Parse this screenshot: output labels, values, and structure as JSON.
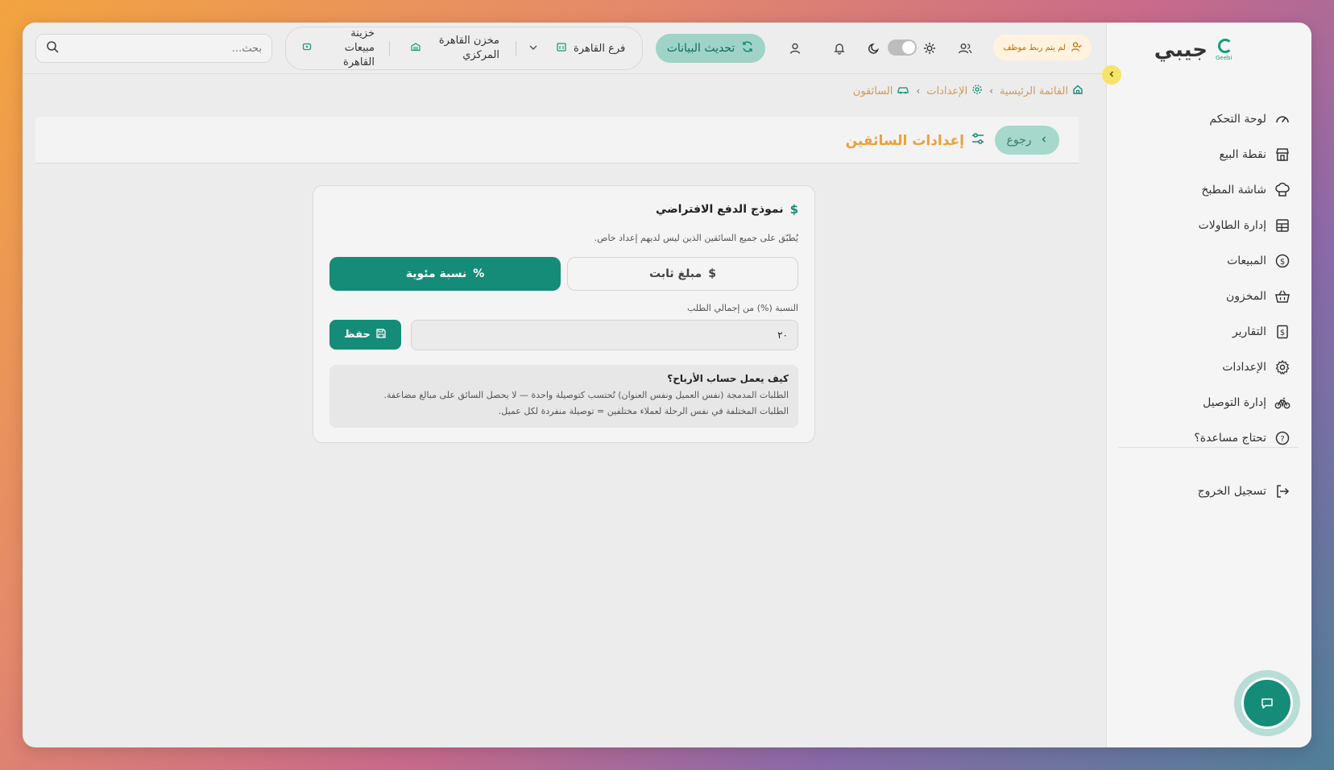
{
  "app": {
    "brand_name": "جيبي",
    "brand_logo_text": "Geebi"
  },
  "sidebar": {
    "items": [
      {
        "label": "لوحة التحكم",
        "icon": "gauge-icon"
      },
      {
        "label": "نقطة البيع",
        "icon": "store-icon"
      },
      {
        "label": "شاشة المطبخ",
        "icon": "chef-hat-icon"
      },
      {
        "label": "إدارة الطاولات",
        "icon": "table-grid-icon"
      },
      {
        "label": "المبيعات",
        "icon": "dollar-circle-icon"
      },
      {
        "label": "المخزون",
        "icon": "basket-icon"
      },
      {
        "label": "التقارير",
        "icon": "report-dollar-icon"
      },
      {
        "label": "الإعدادات",
        "icon": "gear-icon"
      },
      {
        "label": "إدارة التوصيل",
        "icon": "bike-icon"
      },
      {
        "label": "تحتاج مساعدة؟",
        "icon": "help-circle-icon"
      }
    ],
    "logout_label": "تسجيل الخروج"
  },
  "topbar": {
    "search_placeholder": "بحث...",
    "treasury": "خزينة مبيعات القاهرة",
    "warehouse": "مخزن القاهرة المركزي",
    "branch": "فرع القاهرة",
    "refresh_label": "تحديث البيانات",
    "employee_badge": "لم يتم ربط موظف"
  },
  "breadcrumb": {
    "home": "القائمة الرئيسية",
    "settings": "الإعدادات",
    "drivers": "السائقون"
  },
  "page": {
    "back_label": "رجوع",
    "title": "إعدادات السائقين"
  },
  "card": {
    "title": "نموذج الدفع الافتراضي",
    "subtitle": "يُطبّق على جميع السائقين الذين ليس لديهم إعداد خاص.",
    "option_fixed": "مبلغ ثابت",
    "option_percent": "نسبة مئوية",
    "selected_option": "نسبة مئوية",
    "field_label": "النسبة (%) من إجمالي الطلب",
    "field_value": "٢٠",
    "save_label": "حفظ",
    "info_title": "كيف يعمل حساب الأرباح؟",
    "info_line1": "الطلبات المدمجة (نفس العميل ونفس العنوان) تُحتسب كتوصيلة واحدة — لا يحصل السائق على مبالغ مضاعفة.",
    "info_line2": "الطلبات المختلفة في نفس الرحلة لعملاء مختلفين = توصيلة منفردة لكل عميل."
  },
  "colors": {
    "primary": "#158c78",
    "accent": "#e8a13a",
    "refresh_bg": "#9fd3c7",
    "collapse_btn": "#f6e36a"
  }
}
